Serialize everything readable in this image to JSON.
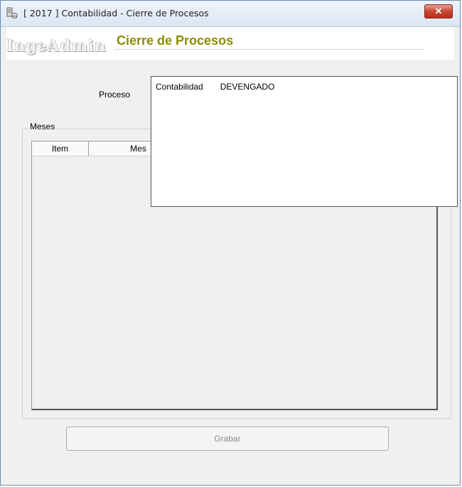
{
  "window": {
    "title": "[ 2017 ] Contabilidad - Cierre de Procesos",
    "close_glyph": "✕",
    "icon": "database-icon"
  },
  "header": {
    "logo_text": "IngeAdmin",
    "form_title": "Cierre de Procesos"
  },
  "proceso": {
    "label": "Proceso",
    "value": "",
    "options": [
      {
        "modulo": "Contabilidad",
        "proceso": "DEVENGADO"
      }
    ]
  },
  "meses": {
    "group_label": "Meses",
    "columns": [
      "Item",
      "Mes"
    ]
  },
  "actions": {
    "grabar_label": "Grabar"
  },
  "colors": {
    "form_title": "#8b8b00",
    "close_button": "#c8462f"
  }
}
